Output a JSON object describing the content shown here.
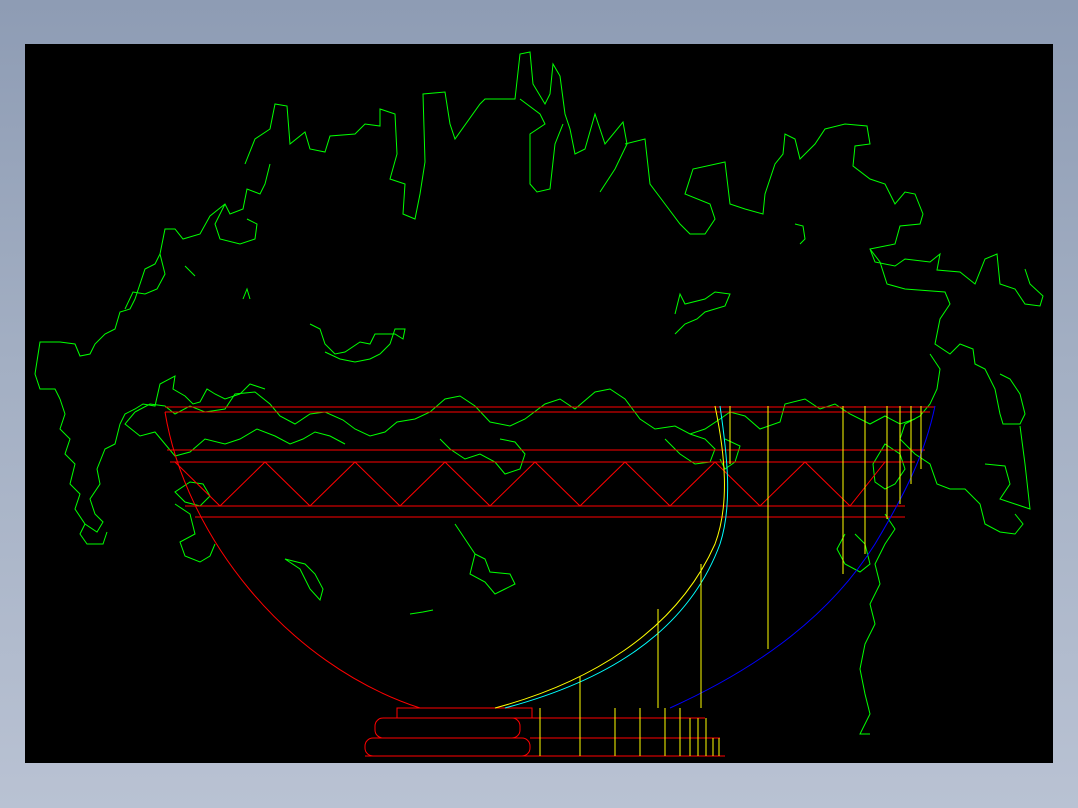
{
  "viewport": {
    "background_top": "#8e9cb4",
    "background_bottom": "#b9c2d3",
    "canvas_color": "#000000"
  },
  "drawing": {
    "subject": "cad-flower-bowl-elevation",
    "line_colors": {
      "foliage": "#00ff00",
      "bowl_outline": "#ff0000",
      "guide_lines": "#ffff00",
      "inner_arc": "#00ffff",
      "outer_arc": "#0000ff"
    }
  }
}
